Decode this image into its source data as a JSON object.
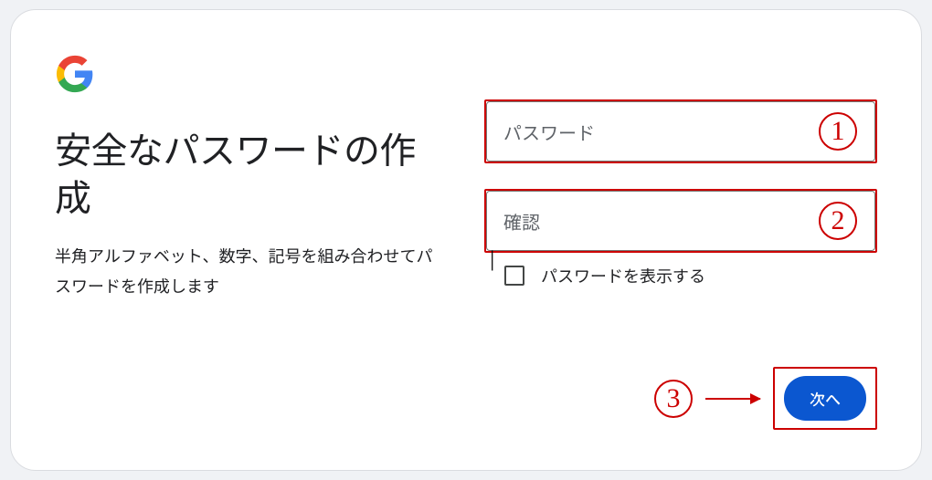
{
  "heading": "安全なパスワードの作成",
  "subtitle": "半角アルファベット、数字、記号を組み合わせてパスワードを作成します",
  "inputs": {
    "password": {
      "placeholder": "パスワード",
      "value": ""
    },
    "confirm": {
      "placeholder": "確認",
      "value": ""
    }
  },
  "checkbox": {
    "label": "パスワードを表示する"
  },
  "next_button": {
    "label": "次へ"
  },
  "annotations": {
    "n1": "1",
    "n2": "2",
    "n3": "3"
  }
}
